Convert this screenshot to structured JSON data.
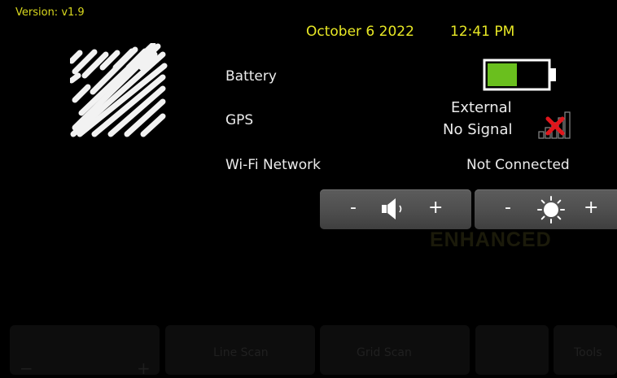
{
  "version": "Version: v1.9",
  "date": "October 6 2022",
  "time": "12:41 PM",
  "status": {
    "battery_label": "Battery",
    "battery_level": 0.5,
    "gps_label": "GPS",
    "gps_source": "External",
    "gps_status": "No Signal",
    "wifi_label": "Wi-Fi Network",
    "wifi_status": "Not Connected"
  },
  "controls": {
    "volume": {
      "minus": "-",
      "plus": "+",
      "icon": "speaker-icon"
    },
    "brightness": {
      "minus": "-",
      "plus": "+",
      "icon": "sun-icon"
    }
  },
  "background": {
    "watermark": "ENHANCED",
    "tabs": [
      "Line Scan",
      "Grid Scan",
      "Tools"
    ]
  },
  "colors": {
    "accent_yellow": "#e8e825",
    "battery_green": "#6abf1e",
    "signal_red": "#e0161c"
  }
}
